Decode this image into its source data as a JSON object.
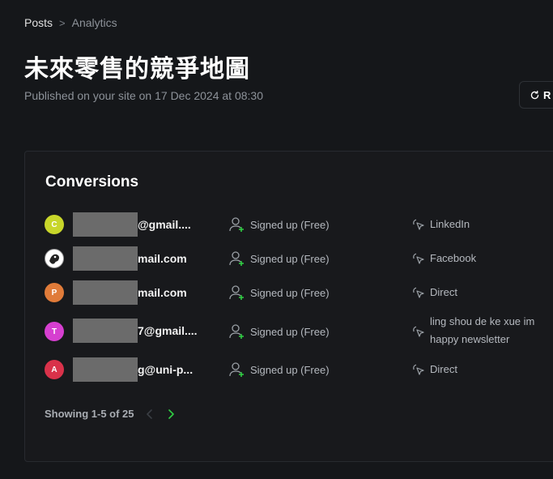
{
  "breadcrumb": {
    "parent": "Posts",
    "separator": ">",
    "current": "Analytics"
  },
  "page": {
    "title": "未來零售的競爭地圖",
    "published": "Published on your site on 17 Dec 2024 at 08:30"
  },
  "refresh_button": {
    "label": "R"
  },
  "conversions": {
    "title": "Conversions",
    "rows": [
      {
        "avatar_letter": "C",
        "avatar_color": "#c8d62a",
        "email_visible": "@gmail....",
        "event": "Signed up (Free)",
        "source": "LinkedIn"
      },
      {
        "avatar_letter": "",
        "avatar_color": "#ffffff",
        "email_visible": "mail.com",
        "event": "Signed up (Free)",
        "source": "Facebook"
      },
      {
        "avatar_letter": "P",
        "avatar_color": "#e07b39",
        "email_visible": "mail.com",
        "event": "Signed up (Free)",
        "source": "Direct"
      },
      {
        "avatar_letter": "T",
        "avatar_color": "#d63fd0",
        "email_visible": "7@gmail....",
        "event": "Signed up (Free)",
        "source": "ling shou de ke xue im happy newsletter"
      },
      {
        "avatar_letter": "A",
        "avatar_color": "#d9324a",
        "email_visible": "g@uni-p...",
        "event": "Signed up (Free)",
        "source": "Direct"
      }
    ],
    "pagination": {
      "showing": "Showing 1-5 of 25"
    }
  },
  "colors": {
    "accent_green": "#30cf43",
    "background": "#15171a",
    "card": "#18191c"
  }
}
